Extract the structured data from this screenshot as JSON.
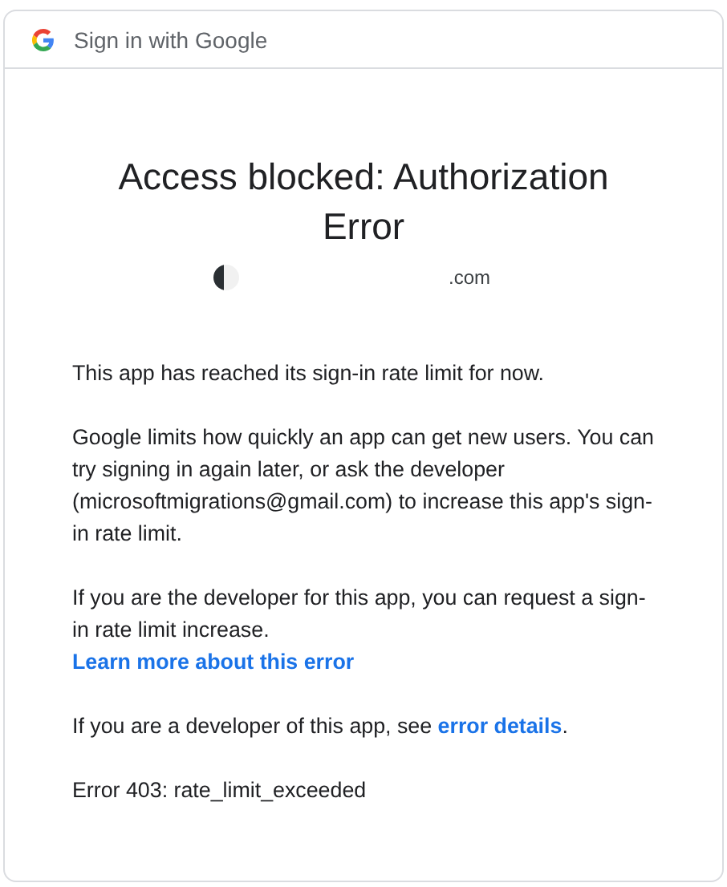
{
  "header": {
    "title": "Sign in with Google"
  },
  "title": "Access blocked: Authorization Error",
  "account": {
    "email_visible": ".com"
  },
  "paragraphs": [
    {
      "parts": [
        {
          "kind": "text",
          "text": "This app has reached its sign-in rate limit for now."
        }
      ]
    },
    {
      "parts": [
        {
          "kind": "text",
          "text": "Google limits how quickly an app can get new users. You can try signing in again later, or ask the developer (microsoftmigrations@gmail.com) to increase this app's sign-in rate limit."
        }
      ]
    },
    {
      "parts": [
        {
          "kind": "text",
          "text": "If you are the developer for this app, you can request a sign-in rate limit increase."
        },
        {
          "kind": "block_link",
          "text": "Learn more about this error"
        }
      ]
    },
    {
      "parts": [
        {
          "kind": "text",
          "text": "If you are a developer of this app, see "
        },
        {
          "kind": "link",
          "text": "error details"
        },
        {
          "kind": "text",
          "text": "."
        }
      ]
    },
    {
      "parts": [
        {
          "kind": "text",
          "text": "Error 403: rate_limit_exceeded"
        }
      ]
    }
  ]
}
